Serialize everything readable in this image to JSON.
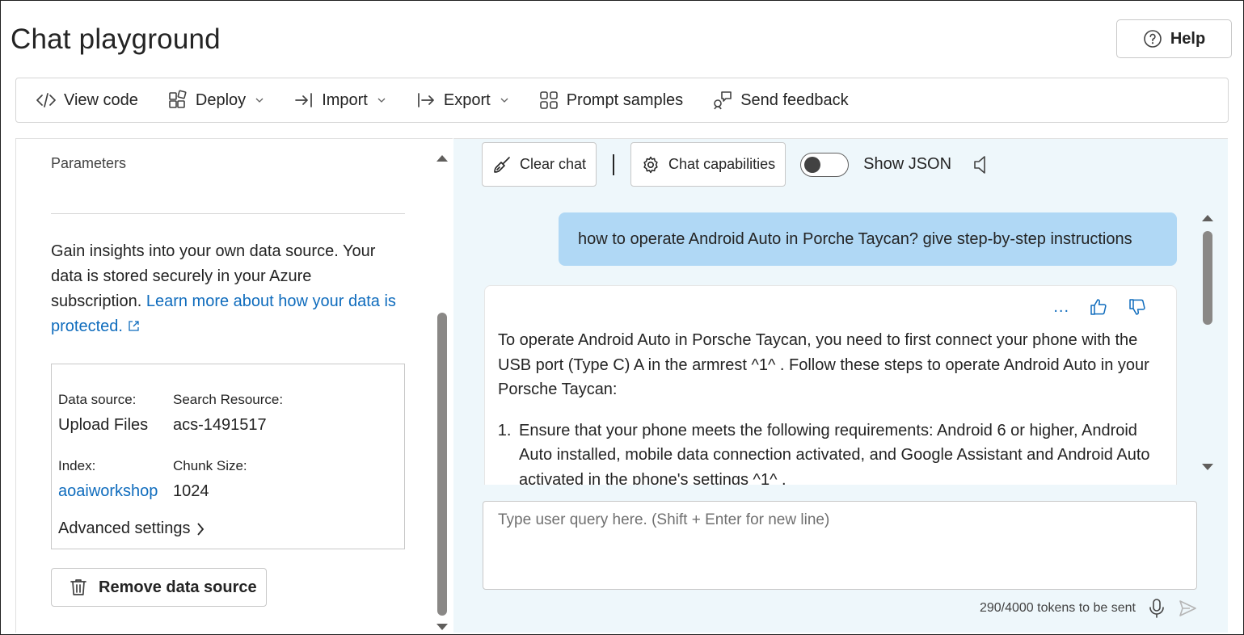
{
  "page": {
    "title": "Chat playground",
    "help_label": "Help"
  },
  "toolbar": {
    "items": [
      {
        "label": "View code",
        "icon": "code-icon",
        "has_dropdown": false
      },
      {
        "label": "Deploy",
        "icon": "deploy-icon",
        "has_dropdown": true
      },
      {
        "label": "Import",
        "icon": "import-icon",
        "has_dropdown": true
      },
      {
        "label": "Export",
        "icon": "export-icon",
        "has_dropdown": true
      },
      {
        "label": "Prompt samples",
        "icon": "grid-icon",
        "has_dropdown": false
      },
      {
        "label": "Send feedback",
        "icon": "feedback-icon",
        "has_dropdown": false
      }
    ]
  },
  "parameters": {
    "title": "Parameters",
    "description": "Gain insights into your own data source. Your data is stored securely in your Azure subscription.",
    "learn_more_link": "Learn more about how your data is protected.",
    "data_source_label": "Data source:",
    "data_source_value": "Upload Files",
    "search_resource_label": "Search Resource:",
    "search_resource_value": "acs-1491517",
    "index_label": "Index:",
    "index_value": "aoaiworkshop",
    "chunk_size_label": "Chunk Size:",
    "chunk_size_value": "1024",
    "advanced_settings": "Advanced settings",
    "remove_data_source": "Remove data source"
  },
  "chat": {
    "clear_chat": "Clear chat",
    "chat_capabilities": "Chat capabilities",
    "show_json": "Show JSON",
    "show_json_on": false,
    "user_message": "how to operate Android Auto in Porche Taycan? give step-by-step instructions",
    "assistant_more": "...",
    "assistant_intro": "To operate Android Auto in Porsche Taycan, you need to first connect your phone with the USB port (Type C) A in the armrest ^1^ . Follow these steps to operate Android Auto in your Porsche Taycan:",
    "assistant_steps": [
      "Ensure that your phone meets the following requirements: Android 6 or higher, Android Auto installed, mobile data connection activated, and Google Assistant and Android Auto activated in the phone's settings ^1^ ."
    ],
    "input_placeholder": "Type user query here. (Shift + Enter for new line)",
    "token_count": "290/4000 tokens to be sent"
  },
  "colors": {
    "accent": "#0f6cbd",
    "user_bubble": "#b0d8f5",
    "chat_background": "#eef7fb"
  }
}
